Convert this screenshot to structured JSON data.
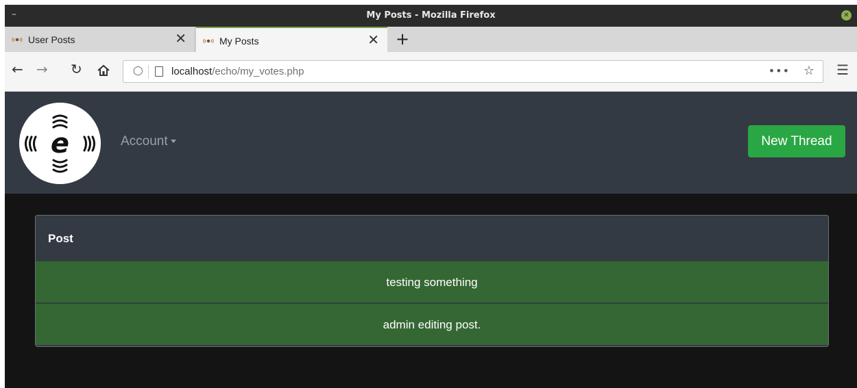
{
  "window": {
    "title": "My Posts - Mozilla Firefox"
  },
  "tabs": [
    {
      "label": "User Posts"
    },
    {
      "label": "My Posts"
    }
  ],
  "address_bar": {
    "host": "localhost",
    "path": "/echo/my_votes.php",
    "overflow": "•••"
  },
  "site": {
    "logo_letter": "e",
    "account_label": "Account",
    "new_thread_label": "New Thread"
  },
  "table": {
    "header": "Post",
    "rows": [
      "testing something",
      "admin editing post."
    ]
  },
  "colors": {
    "header_bg": "#343a44",
    "row_bg": "#356734",
    "button_bg": "#2aa745",
    "page_bg": "#141414"
  }
}
